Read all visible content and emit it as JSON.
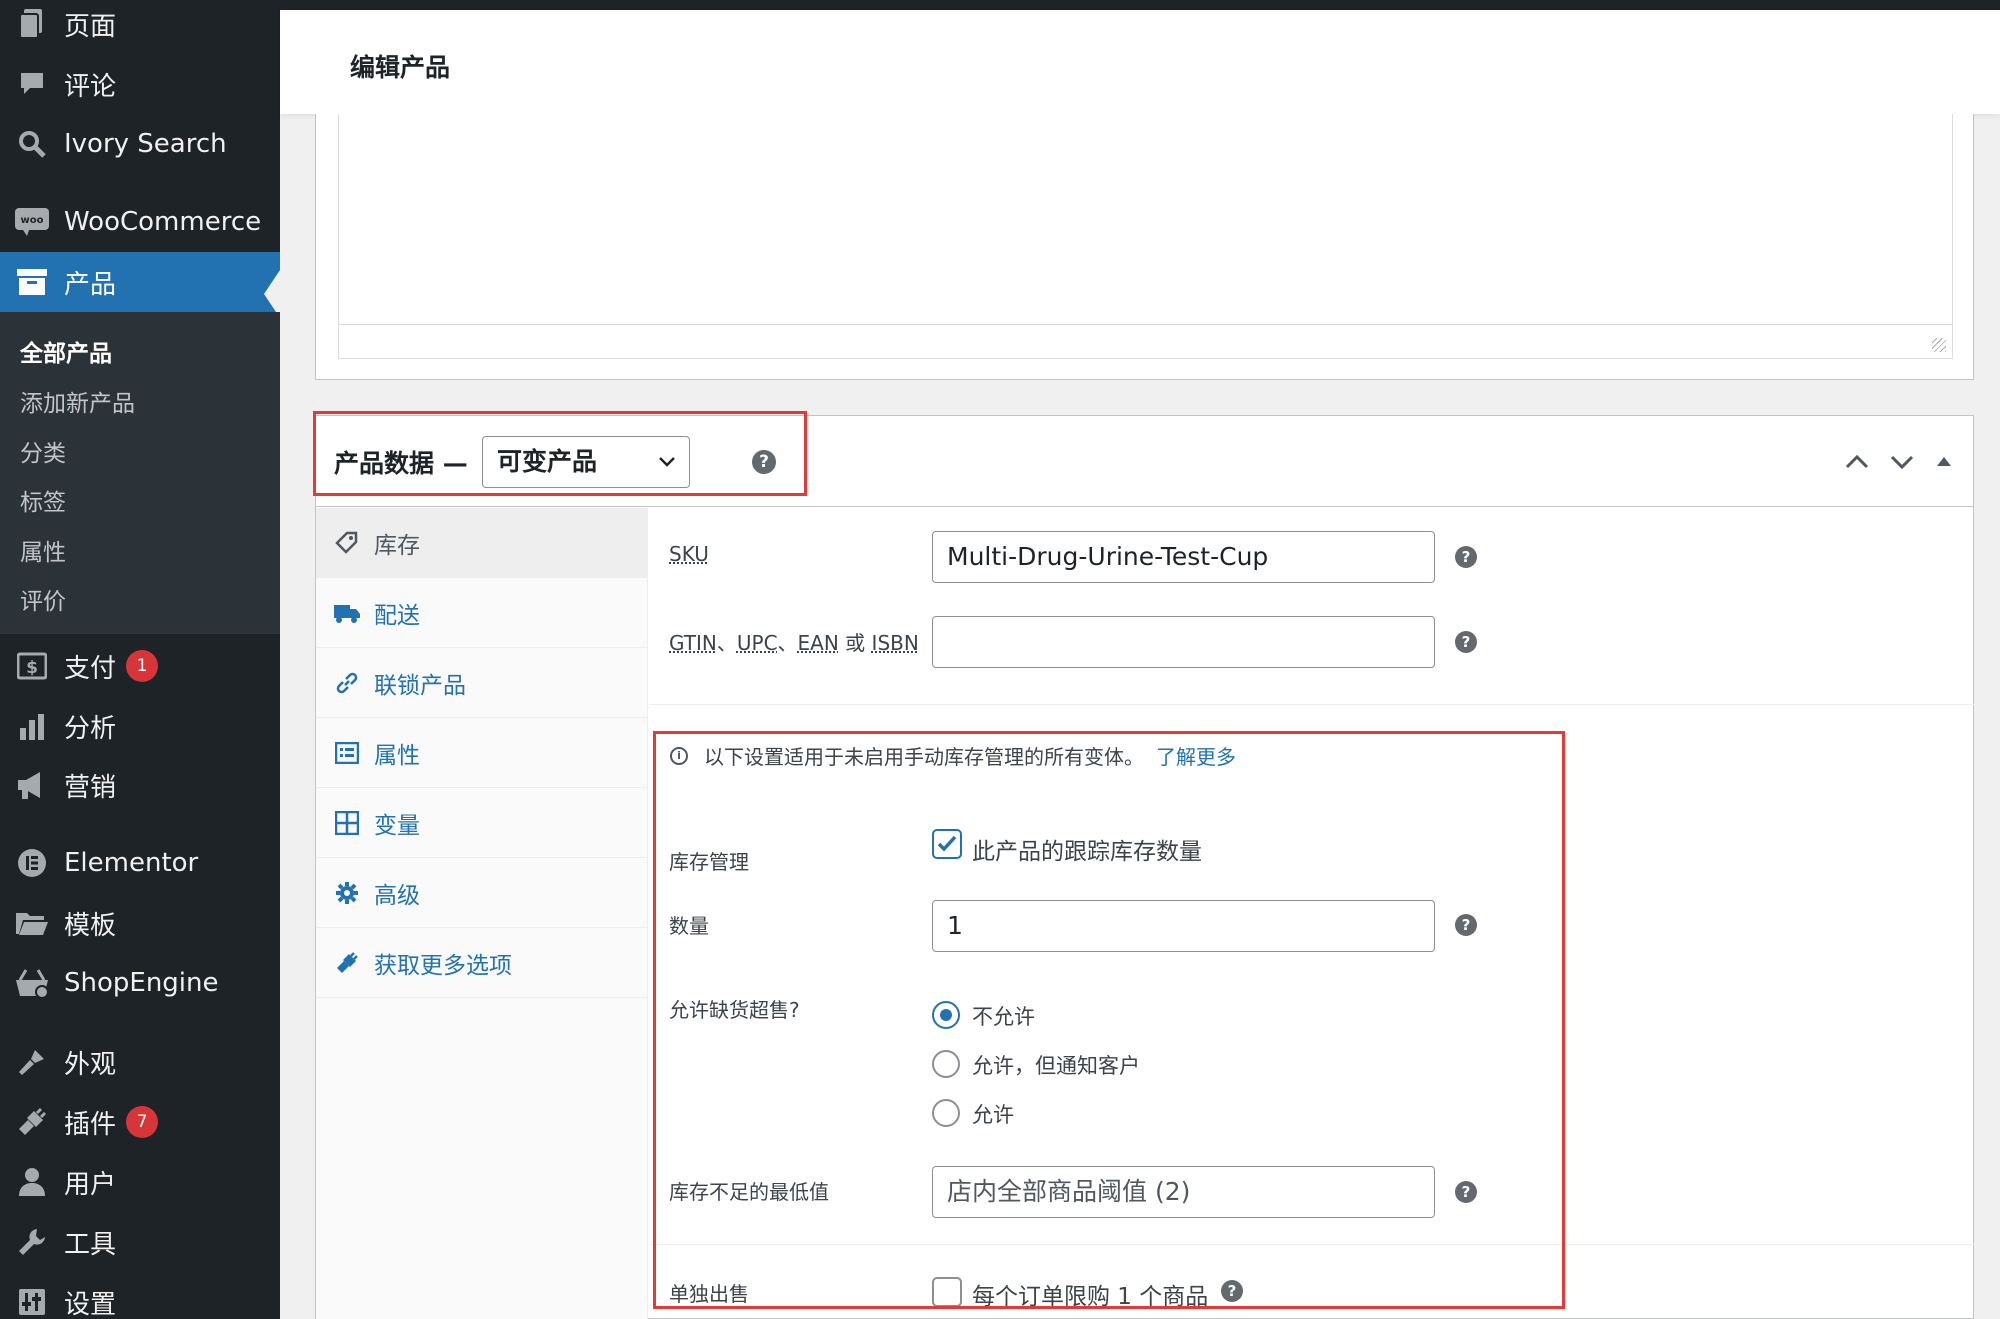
{
  "sidebar": {
    "menu": [
      {
        "label": "页面",
        "icon": "pages-icon"
      },
      {
        "label": "评论",
        "icon": "comments-icon"
      },
      {
        "label": "Ivory Search",
        "icon": "search-icon"
      },
      {
        "label": "WooCommerce",
        "icon": "woocommerce-icon"
      },
      {
        "label": "产品",
        "icon": "archive-icon"
      },
      {
        "label": "支付",
        "icon": "payment-icon",
        "badge": "1"
      },
      {
        "label": "分析",
        "icon": "chart-bar-icon"
      },
      {
        "label": "营销",
        "icon": "megaphone-icon"
      },
      {
        "label": "Elementor",
        "icon": "elementor-icon"
      },
      {
        "label": "模板",
        "icon": "folder-icon"
      },
      {
        "label": "ShopEngine",
        "icon": "basket-icon"
      },
      {
        "label": "外观",
        "icon": "brush-icon"
      },
      {
        "label": "插件",
        "icon": "plugin-icon",
        "badge": "7"
      },
      {
        "label": "用户",
        "icon": "user-icon"
      },
      {
        "label": "工具",
        "icon": "wrench-icon"
      },
      {
        "label": "设置",
        "icon": "settings-icon"
      }
    ],
    "submenu": [
      "全部产品",
      "添加新产品",
      "分类",
      "标签",
      "属性",
      "评价"
    ]
  },
  "header": {
    "title": "编辑产品"
  },
  "product_data": {
    "title": "产品数据 —",
    "type_select": "可变产品",
    "help": "?",
    "tabs": [
      {
        "label": "库存",
        "icon": "tag-icon"
      },
      {
        "label": "配送",
        "icon": "truck-icon"
      },
      {
        "label": "联锁产品",
        "icon": "link-icon"
      },
      {
        "label": "属性",
        "icon": "list-icon"
      },
      {
        "label": "变量",
        "icon": "grid-icon"
      },
      {
        "label": "高级",
        "icon": "gear-icon"
      },
      {
        "label": "获取更多选项",
        "icon": "plug-icon"
      }
    ],
    "inventory": {
      "sku_label": "SKU",
      "sku_value": "Multi-Drug-Urine-Test-Cup",
      "gtin_label_parts": [
        "GTIN",
        "、",
        "UPC",
        "、",
        "EAN",
        " 或 ",
        "ISBN"
      ],
      "gtin_value": "",
      "notice": "以下设置适用于未启用手动库存管理的所有变体。",
      "notice_link": "了解更多",
      "manage_label": "库存管理",
      "manage_checkbox": "此产品的跟踪库存数量",
      "qty_label": "数量",
      "qty_value": "1",
      "backorder_label": "允许缺货超售?",
      "backorder_options": [
        "不允许",
        "允许，但通知客户",
        "允许"
      ],
      "low_stock_label": "库存不足的最低值",
      "low_stock_value": "店内全部商品阈值 (2)",
      "sold_individually_label": "单独出售",
      "sold_individually_checkbox": "每个订单限购 1 个商品"
    }
  },
  "colors": {
    "accent": "#2271b1",
    "sidebar": "#1d2327",
    "highlight": "#e53935",
    "badge": "#d63638"
  }
}
